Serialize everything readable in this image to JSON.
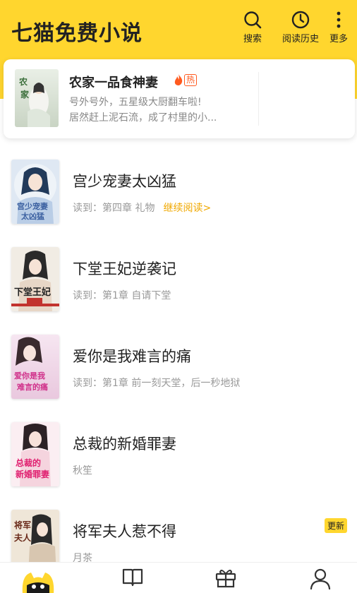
{
  "app": {
    "title": "七猫免费小说"
  },
  "header": {
    "search_label": "搜索",
    "history_label": "阅读历史",
    "more_label": "更多"
  },
  "featured": {
    "title": "农家一品食神妻",
    "badge": "热",
    "desc_line1": "号外号外，五星级大厨翻车啦!",
    "desc_line2": "居然赶上泥石流，成了村里的小..."
  },
  "books": [
    {
      "title": "宫少宠妻太凶猛",
      "sub": "读到：第四章 礼物",
      "action": "继续阅读>"
    },
    {
      "title": "下堂王妃逆袭记",
      "sub": "读到：第1章 自请下堂"
    },
    {
      "title": "爱你是我难言的痛",
      "sub": "读到：第1章 前一刻天堂，后一秒地狱"
    },
    {
      "title": "总裁的新婚罪妻",
      "sub": "秋笙"
    },
    {
      "title": "将军夫人惹不得",
      "sub": "月茶",
      "badge": "更新"
    }
  ],
  "colors": {
    "brand": "#ffd62e",
    "accent": "#f0a800",
    "hot": "#ff5a1f"
  },
  "icons": {
    "header": [
      "search-icon",
      "clock-icon",
      "more-vertical-icon"
    ],
    "nav": [
      "cat-logo-icon",
      "book-open-icon",
      "gift-icon",
      "user-icon"
    ]
  }
}
